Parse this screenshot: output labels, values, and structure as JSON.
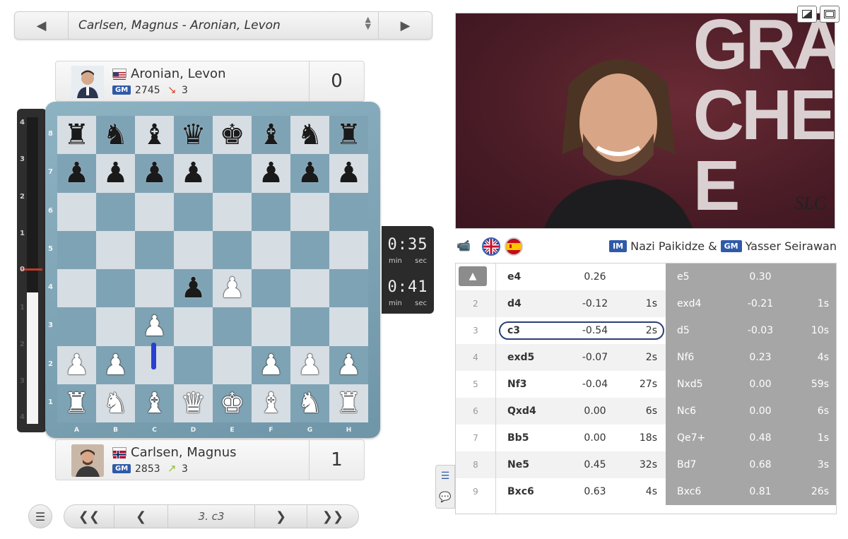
{
  "game_selector": {
    "title": "Carlsen, Magnus - Aronian, Levon",
    "prev_icon": "caret-left-icon",
    "next_icon": "caret-right-icon"
  },
  "players": {
    "top": {
      "name": "Aronian, Levon",
      "title": "GM",
      "rating": "2745",
      "delta": "3",
      "delta_direction": "down",
      "delta_color": "#d9452b",
      "score": "0"
    },
    "bottom": {
      "name": "Carlsen, Magnus",
      "title": "GM",
      "rating": "2853",
      "delta": "3",
      "delta_direction": "up",
      "delta_color": "#8fbf3a",
      "score": "1"
    }
  },
  "eval_bar": {
    "ticks": [
      "4",
      "3",
      "2",
      "1",
      "0",
      "1",
      "2",
      "3",
      "4"
    ],
    "white_fraction": 0.43
  },
  "board": {
    "files": [
      "A",
      "B",
      "C",
      "D",
      "E",
      "F",
      "G",
      "H"
    ],
    "ranks": [
      "8",
      "7",
      "6",
      "5",
      "4",
      "3",
      "2",
      "1"
    ],
    "position": [
      [
        "bR",
        "bN",
        "bB",
        "bQ",
        "bK",
        "bB",
        "bN",
        "bR"
      ],
      [
        "bP",
        "bP",
        "bP",
        "bP",
        "",
        "bP",
        "bP",
        "bP"
      ],
      [
        "",
        "",
        "",
        "",
        "",
        "",
        "",
        ""
      ],
      [
        "",
        "",
        "",
        "",
        "",
        "",
        "",
        ""
      ],
      [
        "",
        "",
        "",
        "bP",
        "wP",
        "",
        "",
        ""
      ],
      [
        "",
        "",
        "wP",
        "",
        "",
        "",
        "",
        ""
      ],
      [
        "wP",
        "wP",
        "",
        "",
        "",
        "wP",
        "wP",
        "wP"
      ],
      [
        "wR",
        "wN",
        "wB",
        "wQ",
        "wK",
        "wB",
        "wN",
        "wR"
      ]
    ],
    "last_move_arrow": "c2-c3"
  },
  "clocks": {
    "top": {
      "time": "0:35",
      "unit_min": "min",
      "unit_sec": "sec"
    },
    "bottom": {
      "time": "0:41",
      "unit_min": "min",
      "unit_sec": "sec"
    }
  },
  "navigation": {
    "current_move": "3. c3",
    "first_icon": "double-chevron-left-icon",
    "prev_icon": "chevron-left-icon",
    "next_icon": "chevron-right-icon",
    "last_icon": "double-chevron-right-icon",
    "menu_icon": "menu-icon"
  },
  "video": {
    "backdrop_text": [
      "GRA",
      "CHE",
      "E"
    ],
    "logo": "SLC"
  },
  "commentators": {
    "first_title": "IM",
    "first_name": "Nazi Paikidze",
    "joiner": "&",
    "second_title": "GM",
    "second_name": "Yasser Seirawan",
    "languages": [
      "English",
      "Spanish"
    ]
  },
  "moves": [
    {
      "num": "1",
      "white": "e4",
      "white_eval": "0.26",
      "white_time": "",
      "black": "e5",
      "black_eval": "0.30",
      "black_time": ""
    },
    {
      "num": "2",
      "white": "d4",
      "white_eval": "-0.12",
      "white_time": "1s",
      "black": "exd4",
      "black_eval": "-0.21",
      "black_time": "1s"
    },
    {
      "num": "3",
      "white": "c3",
      "white_eval": "-0.54",
      "white_time": "2s",
      "black": "d5",
      "black_eval": "-0.03",
      "black_time": "10s"
    },
    {
      "num": "4",
      "white": "exd5",
      "white_eval": "-0.07",
      "white_time": "2s",
      "black": "Nf6",
      "black_eval": "0.23",
      "black_time": "4s"
    },
    {
      "num": "5",
      "white": "Nf3",
      "white_eval": "-0.04",
      "white_time": "27s",
      "black": "Nxd5",
      "black_eval": "0.00",
      "black_time": "59s"
    },
    {
      "num": "6",
      "white": "Qxd4",
      "white_eval": "0.00",
      "white_time": "6s",
      "black": "Nc6",
      "black_eval": "0.00",
      "black_time": "6s"
    },
    {
      "num": "7",
      "white": "Bb5",
      "white_eval": "0.00",
      "white_time": "18s",
      "black": "Qe7+",
      "black_eval": "0.48",
      "black_time": "1s"
    },
    {
      "num": "8",
      "white": "Ne5",
      "white_eval": "0.45",
      "white_time": "32s",
      "black": "Bd7",
      "black_eval": "0.68",
      "black_time": "3s"
    },
    {
      "num": "9",
      "white": "Bxc6",
      "white_eval": "0.63",
      "white_time": "4s",
      "black": "Bxc6",
      "black_eval": "0.81",
      "black_time": "26s"
    }
  ],
  "selected_move": "3. c3",
  "colors": {
    "board_light": "#d6dde3",
    "board_dark": "#7ea3b5",
    "title_badge": "#2f5aa8",
    "move_arrow": "#2a3fcf",
    "black_move_column": "#a6a6a6"
  }
}
